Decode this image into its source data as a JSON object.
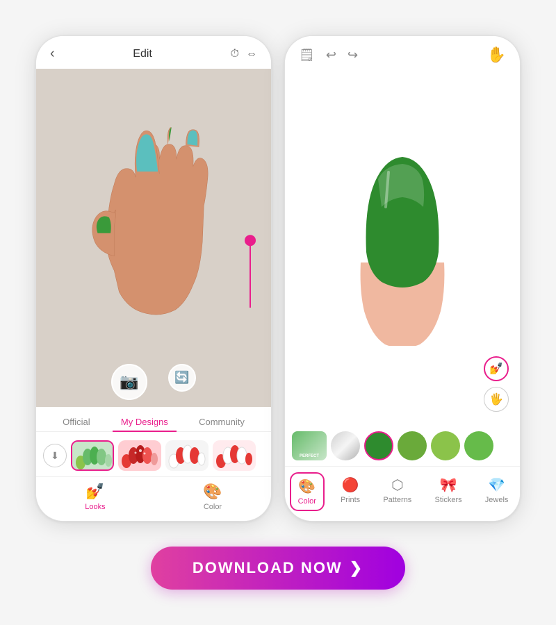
{
  "left_phone": {
    "top_bar": {
      "back_label": "‹",
      "title": "Edit",
      "icon1": "↺",
      "icon2": "⇔"
    },
    "tabs": [
      "Official",
      "My Designs",
      "Community"
    ],
    "active_tab": "My Designs",
    "save_btn_label": "⬇",
    "bottom_nav": [
      {
        "id": "looks",
        "label": "Looks",
        "icon": "💅",
        "active": true
      },
      {
        "id": "color",
        "label": "Color",
        "icon": "🖌",
        "active": false
      }
    ]
  },
  "right_phone": {
    "top_bar": {
      "copy_icon": "📋",
      "undo_icon": "↩",
      "redo_icon": "↪",
      "hand_icon": "✋"
    },
    "color_swatches": [
      {
        "id": "perfect",
        "color": "#4caf50",
        "label": "PERFECT",
        "special": true
      },
      {
        "id": "silver",
        "color": "linear-gradient(135deg,#d0d0d0,#f0f0f0,#a0a0a0)"
      },
      {
        "id": "green_dark",
        "color": "#2e8b2e"
      },
      {
        "id": "green_mid",
        "color": "#6aaa3a"
      },
      {
        "id": "green_light",
        "color": "#8bc34a"
      },
      {
        "id": "green_med2",
        "color": "#66bb4a"
      }
    ],
    "tools": [
      {
        "id": "color",
        "label": "Color",
        "icon": "🎨",
        "active": true
      },
      {
        "id": "prints",
        "label": "Prints",
        "icon": "🔴"
      },
      {
        "id": "patterns",
        "label": "Patterns",
        "icon": "⬡"
      },
      {
        "id": "stickers",
        "label": "Stickers",
        "icon": "🎀"
      },
      {
        "id": "jewels",
        "label": "Jewels",
        "icon": "💎"
      }
    ]
  },
  "download_button": {
    "label": "DOWNLOAD NOW",
    "arrow": "❯"
  }
}
